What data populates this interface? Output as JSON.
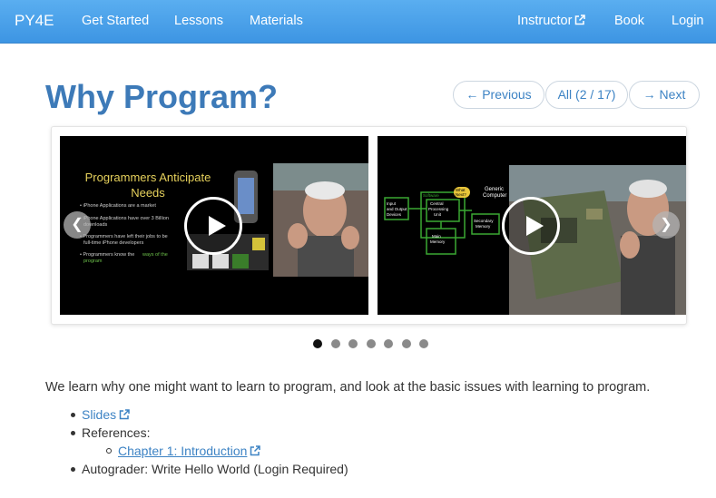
{
  "nav": {
    "brand": "PY4E",
    "get_started": "Get Started",
    "lessons": "Lessons",
    "materials": "Materials",
    "instructor": "Instructor",
    "book": "Book",
    "login": "Login"
  },
  "header": {
    "title": "Why Program?",
    "previous": "← Previous",
    "all": "All (2 / 17)",
    "next": "→ Next"
  },
  "slides": [
    {
      "title": "Programmers Anticipate Needs",
      "bullets": [
        "iPhone Applications are a market",
        "iPhone Applications have over 3 Billion downloads",
        "Programmers have left their jobs to be full-time iPhone developers",
        "Programmers know the ways of the program"
      ]
    },
    {
      "title": "Generic Computer",
      "boxes": [
        "Software",
        "Input and Output Devices",
        "Central Processing Unit",
        "Main Memory",
        "Secondary Memory",
        "What Next?"
      ]
    }
  ],
  "carousel": {
    "dot_count": 7,
    "active_dot": 1
  },
  "content": {
    "description": "We learn why one might want to learn to program, and look at the basic issues with learning to program.",
    "slides_link": "Slides",
    "references_label": "References:",
    "chapter_link": "Chapter 1: Introduction",
    "autograder": "Autograder: Write Hello World (Login Required)"
  },
  "colors": {
    "navbar": "#4aa3ec",
    "title": "#3d7ab8",
    "link": "#3d83c4"
  }
}
